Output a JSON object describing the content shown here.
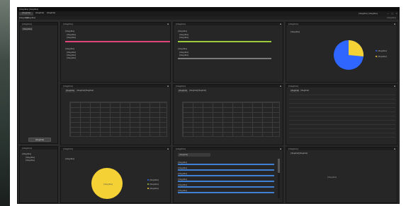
{
  "window": {
    "title": "[illegible] [illegible]"
  },
  "menu": {
    "tabs": [
      "[illegible]",
      "[illegible]",
      "[illegible]"
    ],
    "sub_items": [
      "[illegible]",
      "[illegible]"
    ],
    "right_status": "[illegible] [illegible]",
    "right_path": "[illegible]"
  },
  "left_top": {
    "title": "[illegible]",
    "item": "[illegible]",
    "button": "[illegible]"
  },
  "left_bottom": {
    "title": "[illegible]",
    "tree_root": "[illegible]",
    "tree_children": [
      "[illegible]",
      "[illegible]"
    ]
  },
  "panels": {
    "p1": {
      "title": "[illegible]",
      "head1": "[illegible]",
      "line1": "[illegible]",
      "line2": "[illegible]",
      "head2": "[illegible]",
      "lines": [
        "[illegible]",
        "[illegible]",
        "[illegible]"
      ]
    },
    "p2": {
      "title": "[illegible]",
      "head1": "[illegible]",
      "line1": "[illegible]",
      "line2": "[illegible]",
      "head2": "[illegible]",
      "lines": [
        "[illegible]",
        "[illegible]"
      ]
    },
    "p3": {
      "title": "[illegible]",
      "chart_label": "[illegible]",
      "legend": [
        "[illegible]",
        "[illegible]"
      ]
    },
    "g1": {
      "title": "[illegible]",
      "tabs": [
        "[illegible]",
        "[illegible]",
        "[illegible]"
      ]
    },
    "g2": {
      "title": "[illegible]",
      "tabs": [
        "[illegible]",
        "[illegible]",
        "[illegible]"
      ]
    },
    "g3": {
      "title": "[illegible]",
      "tabs": [
        "[illegible]",
        "[illegible]"
      ]
    },
    "b1": {
      "title": "[illegible]",
      "label": "[illegible]",
      "pie_label": "[illegible]",
      "legend": [
        "[illegible]",
        "[illegible]",
        "[illegible]"
      ]
    },
    "b2": {
      "title": "[illegible]",
      "filter": "[illegible]",
      "rows": [
        "[illegible]",
        "[illegible]",
        "[illegible]",
        "[illegible]",
        "[illegible]",
        "[illegible]"
      ]
    },
    "b3": {
      "title": "[illegible]",
      "tabs": [
        "[illegible]",
        "[illegible]"
      ],
      "empty": "[illegible]"
    }
  },
  "colors": {
    "pink": "#e0457a",
    "green": "#9ccb3b",
    "gray": "#7a7a7a",
    "blue": "#2f66ff",
    "yellow": "#f4d235",
    "bluebar": "#3f7fd4"
  }
}
